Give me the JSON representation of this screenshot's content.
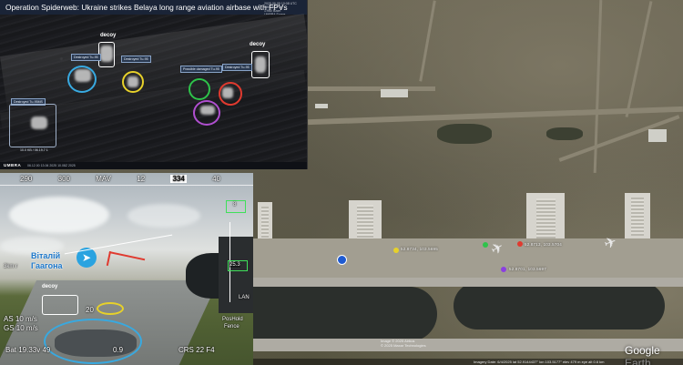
{
  "thermal": {
    "title": "Operation Spiderweb: Ukraine strikes Belaya long range aviation airbase with FPVs",
    "meta_lines": [
      "2025-06-05 10:08 UTC",
      "LBMM/DF7B",
      "1:950 50cm",
      "UMBRA Space"
    ],
    "labels": {
      "decoy": "decoy",
      "destroyed": "Destroyed Tu-95",
      "possibly_damaged": "Possible damaged Tu-95",
      "destroyed_tu95ms": "Destroyed Tu-95MS",
      "caption": "10.0 KB / 06.19.7 1",
      "footer": "UMBRA",
      "footer_detail": "06.12.00 13.06 2025 10.08Z 2025"
    },
    "colors": {
      "blue": "#38a9e0",
      "yellow": "#e7d12a",
      "green": "#2ec34a",
      "red": "#e03a2f",
      "purple": "#b04fd0"
    }
  },
  "fpv": {
    "hud_top": [
      "290",
      "300",
      "MAV",
      "12",
      "334",
      "40"
    ],
    "channel_name_line1": "Віталій",
    "channel_name_line2": "Гаагона",
    "decoy": "decoy",
    "left_readout": "3km r",
    "alt": "AS 10 m/s",
    "gs": "GS 10 m/s",
    "bottom_left": "Bat 19.33v 49",
    "bottom_mid": "0.9",
    "bottom_right": "CRS 22 F4",
    "right_top": "8",
    "right_mid": "PosHold",
    "right_low": "Fence",
    "num_20": "20",
    "right_readout": "25.3",
    "speed_small": "LAN"
  },
  "map": {
    "coord_1": "52.8734, 103.5695",
    "coord_2": "52.8713, 103.5704",
    "coord_3": "52.8701, 103.5697",
    "copyright": "Image © 2025 Airbus",
    "copyright_2": "© 2025 Maxar Technologies",
    "google_earth": "Google Earth",
    "status_bar": "Imagery Date: 6/4/2025   lat  52.9144437°  lon 103.5177°  elev  479 m   eye alt  0.6 km",
    "dot_colors": [
      "#e7d12a",
      "#2ec34a",
      "#e03a2f",
      "#8b3fe0"
    ]
  }
}
